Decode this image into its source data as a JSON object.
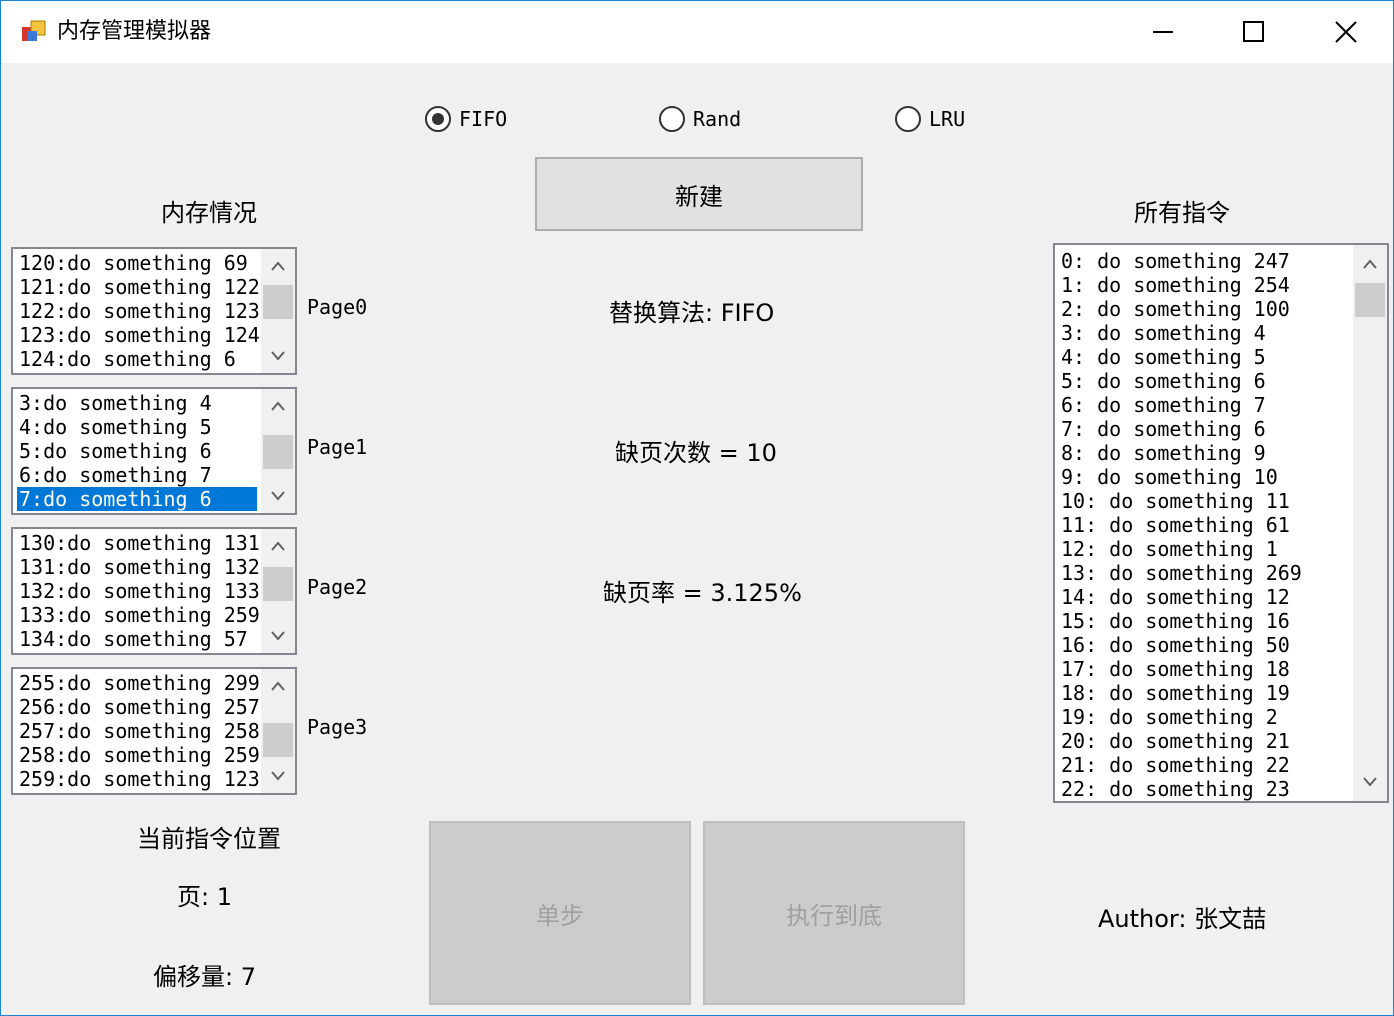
{
  "window": {
    "title": "内存管理模拟器"
  },
  "algorithms": {
    "options": [
      "FIFO",
      "Rand",
      "LRU"
    ],
    "selected": "FIFO"
  },
  "buttons": {
    "new": "新建",
    "step": "单步",
    "run_to_end": "执行到底"
  },
  "memory": {
    "heading": "内存情况",
    "pages": [
      {
        "label": "Page0",
        "items": [
          "120:do something 69",
          "121:do something 122",
          "122:do something 123",
          "123:do something 124",
          "124:do something 6"
        ],
        "selected_index": -1
      },
      {
        "label": "Page1",
        "items": [
          "3:do something 4",
          "4:do something 5",
          "5:do something 6",
          "6:do something 7",
          "7:do something 6"
        ],
        "selected_index": 4
      },
      {
        "label": "Page2",
        "items": [
          "130:do something 131",
          "131:do something 132",
          "132:do something 133",
          "133:do something 259",
          "134:do something 57"
        ],
        "selected_index": -1
      },
      {
        "label": "Page3",
        "items": [
          "255:do something 299",
          "256:do something 257",
          "257:do something 258",
          "258:do something 259",
          "259:do something 123"
        ],
        "selected_index": -1
      }
    ]
  },
  "stats": {
    "algorithm_text": "替换算法: FIFO",
    "fault_count_text": "缺页次数 = 10",
    "fault_rate_text": "缺页率 = 3.125%"
  },
  "instructions": {
    "heading": "所有指令",
    "items": [
      "0: do something 247",
      "1: do something 254",
      "2: do something 100",
      "3: do something 4",
      "4: do something 5",
      "5: do something 6",
      "6: do something 7",
      "7: do something 6",
      "8: do something 9",
      "9: do something 10",
      "10: do something 11",
      "11: do something 61",
      "12: do something 1",
      "13: do something 269",
      "14: do something 12",
      "15: do something 16",
      "16: do something 50",
      "17: do something 18",
      "18: do something 19",
      "19: do something 2",
      "20: do something 21",
      "21: do something 22",
      "22: do something 23"
    ]
  },
  "position": {
    "heading": "当前指令位置",
    "page_text": "页: 1",
    "offset_text": "偏移量: 7"
  },
  "author": {
    "text": "Author: 张文喆"
  },
  "icons": {
    "app": "app-icon",
    "minimize": "minimize-icon",
    "maximize": "maximize-icon",
    "close": "close-icon",
    "scroll_up": "chevron-up-icon",
    "scroll_down": "chevron-down-icon"
  },
  "colors": {
    "selection": "#0078d7",
    "window_border": "#1883d7"
  }
}
